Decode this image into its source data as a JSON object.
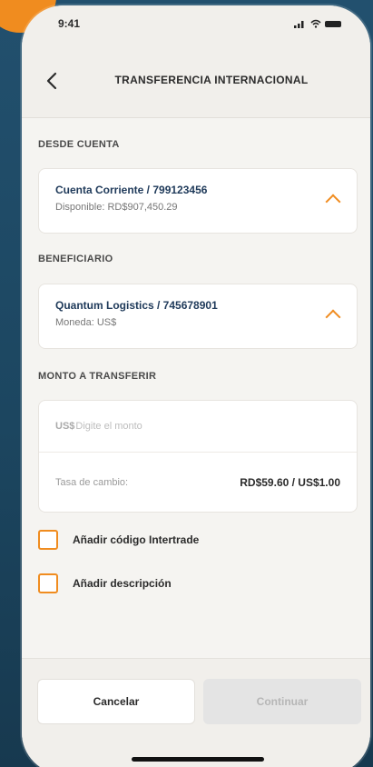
{
  "status": {
    "time": "9:41"
  },
  "nav": {
    "title": "TRANSFERENCIA INTERNACIONAL"
  },
  "from_account": {
    "label": "DESDE CUENTA",
    "title": "Cuenta Corriente / 799123456",
    "subtitle": "Disponible: RD$907,450.29"
  },
  "beneficiary": {
    "label": "BENEFICIARIO",
    "title": "Quantum Logistics / 745678901",
    "subtitle": "Moneda: US$"
  },
  "amount": {
    "label": "MONTO A TRANSFERIR",
    "currency": "US$",
    "placeholder": "Digite el monto",
    "rate_label": "Tasa de cambio:",
    "rate_value": "RD$59.60 / US$1.00"
  },
  "options": {
    "intertrade": "Añadir código Intertrade",
    "description": "Añadir descripción"
  },
  "footer": {
    "cancel": "Cancelar",
    "continue": "Continuar"
  },
  "colors": {
    "accent": "#f08c1f",
    "background": "#1c4660",
    "text_primary": "#1f3a5a"
  },
  "icons": [
    "back-icon",
    "signal-icon",
    "wifi-icon",
    "battery-icon",
    "chevron-up-icon"
  ]
}
